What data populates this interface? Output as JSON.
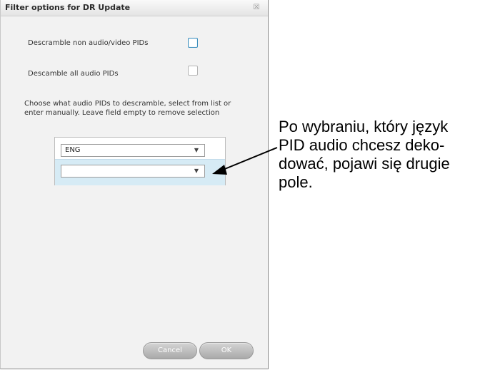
{
  "dialog": {
    "title": "Filter options for DR Update",
    "close_glyph": "☒",
    "descramble_non_av_label": "Descramble non audio/video PIDs",
    "descramble_all_audio_label": "Descamble all audio PIDs",
    "descramble_non_av_checked": false,
    "descramble_all_audio_checked": false,
    "instructions": "Choose what audio PIDs to descramble, select from list or enter manually. Leave field empty to remove selection",
    "pid_selectors": [
      {
        "value": "ENG"
      },
      {
        "value": ""
      }
    ],
    "cancel_label": "Cancel",
    "ok_label": "OK"
  },
  "annotation": {
    "lines": [
      "Po wybraniu, który język",
      "PID audio chcesz deko-",
      "dować, pojawi się drugie",
      "pole."
    ]
  },
  "colors": {
    "accent_border": "#3e8fbd",
    "selected_row": "#d6ebf5",
    "button_gray": "#b8b8b8"
  }
}
